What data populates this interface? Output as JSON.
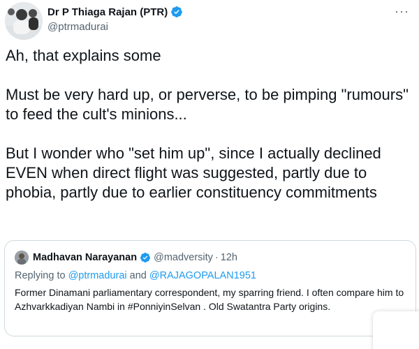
{
  "author": {
    "name": "Dr P Thiaga Rajan (PTR)",
    "handle": "@ptrmadurai"
  },
  "icons": {
    "more": "more-horizontal-icon",
    "verified": "verified-badge-icon"
  },
  "colors": {
    "verified": "#1d9bf0",
    "link": "#1d9bf0",
    "secondary_text": "#536471",
    "border": "#cfd9de"
  },
  "tweet": {
    "paragraphs": [
      "Ah, that explains some",
      "Must be very hard up, or perverse, to be pimping \"rumours\" to feed the cult's minions...",
      "But I wonder who \"set him up\", since I actually declined EVEN when direct flight was suggested, partly due to phobia, partly due to earlier constituency commitments"
    ]
  },
  "quote": {
    "author_name": "Madhavan Narayanan",
    "author_handle": "@madversity",
    "separator": "·",
    "time": "12h",
    "reply_prefix": "Replying to",
    "reply_user_1": "@ptrmadurai",
    "reply_and": "and",
    "reply_user_2": "@RAJAGOPALAN1951",
    "text": "Former Dinamani parliamentary correspondent, my sparring friend. I often compare him to Azhvarkkadiyan Nambi in #PonniyinSelvan . Old Swatantra Party origins."
  }
}
